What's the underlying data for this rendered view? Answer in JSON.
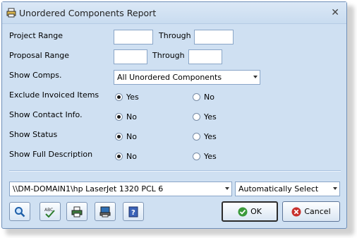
{
  "window": {
    "title": "Unordered Components Report"
  },
  "form": {
    "project_range_label": "Project Range",
    "project_through_label": "Through",
    "proposal_range_label": "Proposal Range",
    "proposal_through_label": "Through",
    "show_comps_label": "Show Comps.",
    "show_comps_value": "All Unordered Components",
    "exclude_invoiced_label": "Exclude Invoiced Items",
    "exclude_invoiced_opt1": "Yes",
    "exclude_invoiced_opt2": "No",
    "show_contact_label": "Show Contact Info.",
    "show_contact_opt1": "No",
    "show_contact_opt2": "Yes",
    "show_status_label": "Show Status",
    "show_status_opt1": "No",
    "show_status_opt2": "Yes",
    "show_full_desc_label": "Show Full Description",
    "show_full_desc_opt1": "No",
    "show_full_desc_opt2": "Yes"
  },
  "printer": {
    "value": "\\\\DM-DOMAIN1\\hp LaserJet 1320 PCL 6",
    "tray": "Automatically Select"
  },
  "buttons": {
    "ok": "OK",
    "cancel": "Cancel"
  },
  "colors": {
    "window_bg": "#cfe0f2",
    "ok_green": "#3a9a3a",
    "cancel_red": "#c8302c"
  }
}
